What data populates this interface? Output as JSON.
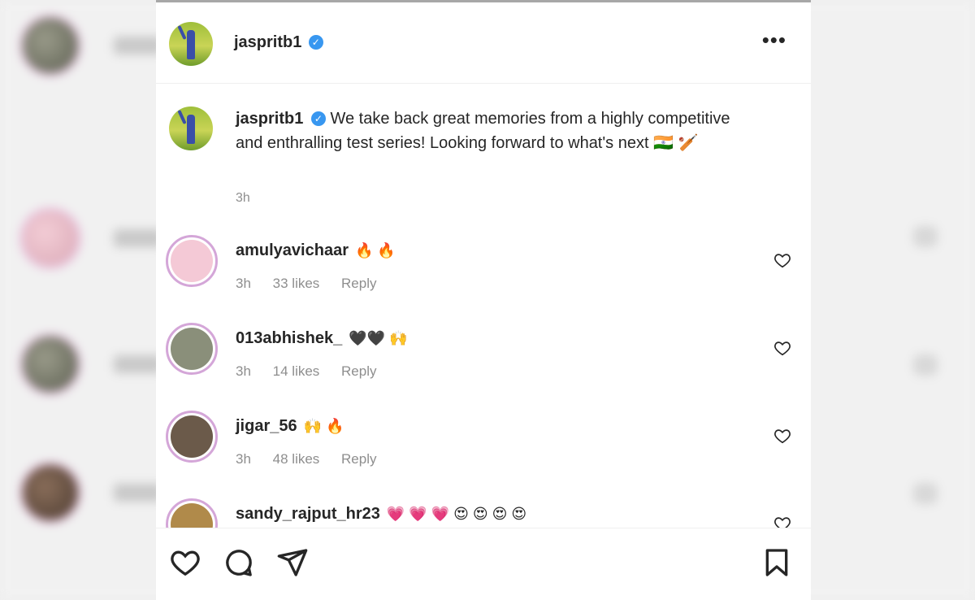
{
  "post": {
    "author": "jaspritb1",
    "verified_mark": "✓",
    "more_label": "•••",
    "caption": "We take back great memories from a highly competitive and enthralling test series! Looking forward to what's next 🇮🇳 🏏",
    "time": "3h"
  },
  "comments": [
    {
      "username": "amulyavichaar",
      "emoji": "🔥 🔥",
      "time": "3h",
      "likes": "33 likes",
      "reply": "Reply",
      "avatar_color": "#f4c9d6"
    },
    {
      "username": "013abhishek_",
      "emoji": "🖤🖤 🙌",
      "time": "3h",
      "likes": "14 likes",
      "reply": "Reply",
      "avatar_color": "#8a8f7a"
    },
    {
      "username": "jigar_56",
      "emoji": "🙌 🔥",
      "time": "3h",
      "likes": "48 likes",
      "reply": "Reply",
      "avatar_color": "#6b5a4a"
    },
    {
      "username": "sandy_rajput_hr23",
      "emoji": "💗 💗 💗 😍 😍 😍 😍",
      "avatar_color": "#b08a4a"
    }
  ],
  "colors": {
    "verified": "#3897f0",
    "text": "#262626",
    "muted": "#8e8e8e",
    "ring": "#d4a6d8"
  },
  "icons": [
    "like-icon",
    "comment-icon",
    "share-icon",
    "save-icon",
    "heart-outline-icon",
    "verified-badge-icon",
    "more-options-icon"
  ]
}
